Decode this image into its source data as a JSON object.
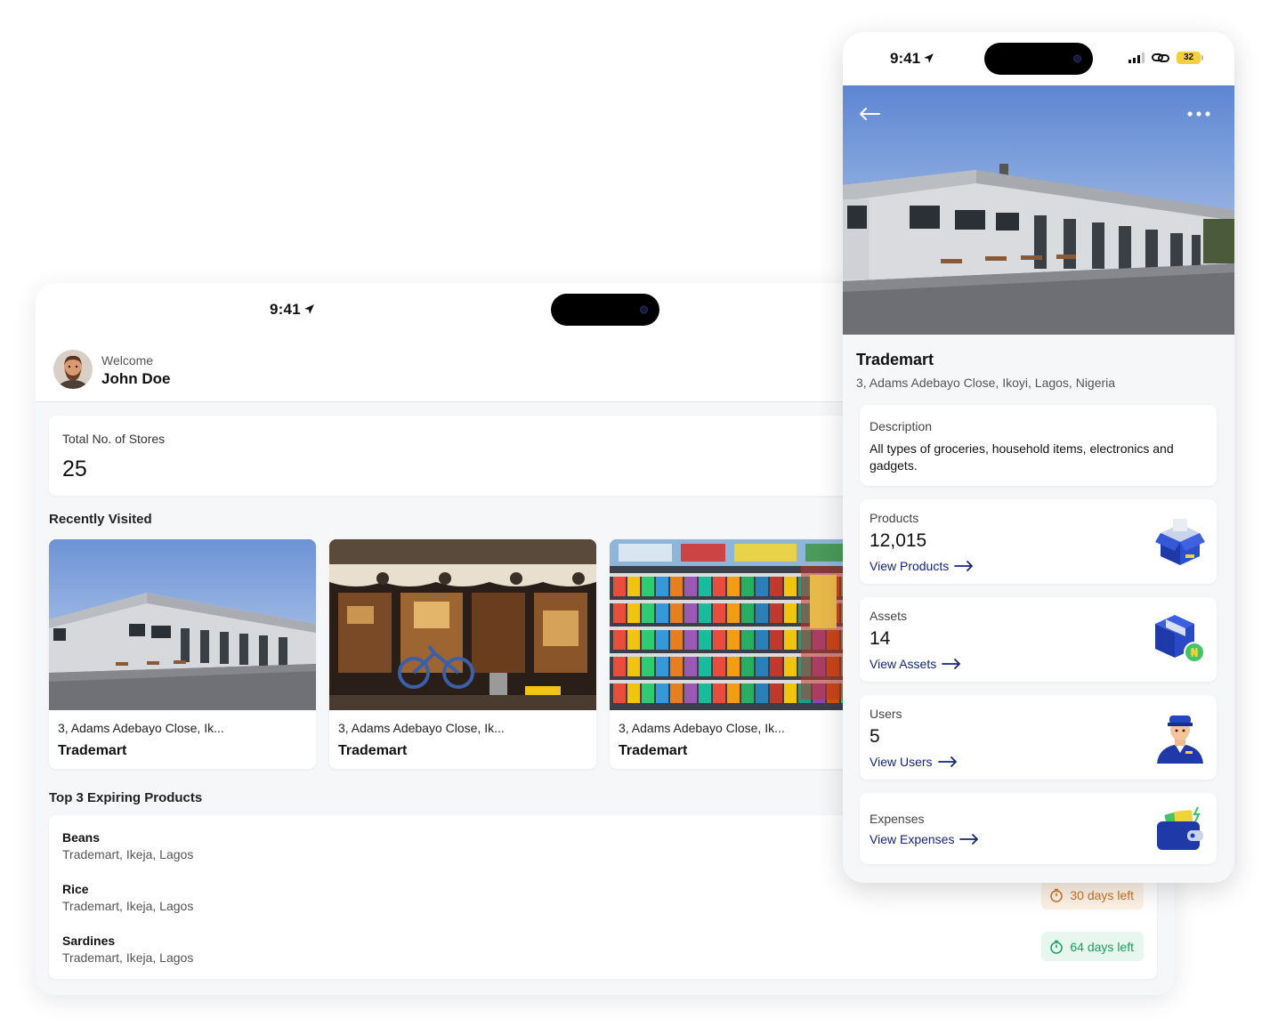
{
  "dashboard": {
    "status_time": "9:41",
    "welcome_label": "Welcome",
    "user_name": "John Doe",
    "stores_label": "Total No. of Stores",
    "stores_count": "25",
    "recently_visited_title": "Recently Visited",
    "recent_stores": [
      {
        "address": "3, Adams Adebayo Close, Ik...",
        "name": "Trademart",
        "image": "warehouse-photo"
      },
      {
        "address": "3, Adams Adebayo Close, Ik...",
        "name": "Trademart",
        "image": "street-shop-photo"
      },
      {
        "address": "3, Adams Adebayo Close, Ik...",
        "name": "Trademart",
        "image": "supermarket-shelves-photo"
      }
    ],
    "expiring_title": "Top 3 Expiring Products",
    "expiring": [
      {
        "name": "Beans",
        "location": "Trademart, Ikeja, Lagos",
        "badge": ""
      },
      {
        "name": "Rice",
        "location": "Trademart, Ikeja, Lagos",
        "badge": "30 days left",
        "badge_color": "#c9731d",
        "badge_bg": "#fdf1e6"
      },
      {
        "name": "Sardines",
        "location": "Trademart, Ikeja, Lagos",
        "badge": "64 days left",
        "badge_color": "#1a9e5a",
        "badge_bg": "#e7f6ee"
      }
    ]
  },
  "store_detail": {
    "status_time": "9:41",
    "battery": "32",
    "store_name": "Trademart",
    "address": "3, Adams Adebayo Close, Ikoyi, Lagos, Nigeria",
    "description_label": "Description",
    "description": "All types of groceries, household items, electronics and gadgets.",
    "products_label": "Products",
    "products_value": "12,015",
    "products_link": "View Products",
    "assets_label": "Assets",
    "assets_value": "14",
    "assets_link": "View Assets",
    "users_label": "Users",
    "users_value": "5",
    "users_link": "View Users",
    "expenses_label": "Expenses",
    "expenses_link": "View Expenses",
    "accent_color": "#16257a"
  }
}
